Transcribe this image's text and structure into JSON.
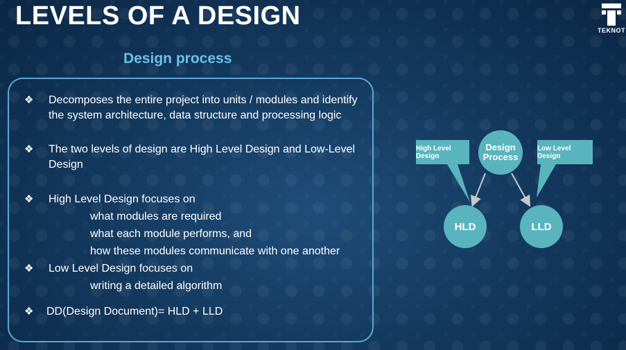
{
  "slide": {
    "title": "LEVELS OF A DESIGN",
    "subtitle": "Design process",
    "logo_text": "TEKNOT"
  },
  "bullets": [
    {
      "text": "Decomposes the entire project into units / modules and identify the system architecture, data structure and processing logic"
    },
    {
      "text": "The two levels of design are High Level Design and Low-Level Design"
    },
    {
      "text": "High Level Design focuses on",
      "sub": [
        "what modules are required",
        "what each module performs, and",
        "how these modules communicate with one another"
      ]
    },
    {
      "text": "Low Level Design focuses on",
      "sub": [
        "writing a detailed algorithm"
      ]
    },
    {
      "text": "DD(Design Document)= HLD + LLD"
    }
  ],
  "diagram": {
    "center": "Design Process",
    "left_node": "HLD",
    "right_node": "LLD",
    "left_callout": "High Level Design",
    "right_callout": "Low Level Design"
  },
  "colors": {
    "title": "#ffffff",
    "subtitle": "#6ec0e6",
    "box_border": "#5aa8d8",
    "node_fill": "#5ab4be"
  },
  "icons": {
    "bullet": "diamond-bullet-icon",
    "logo": "teknot-logo-icon"
  }
}
